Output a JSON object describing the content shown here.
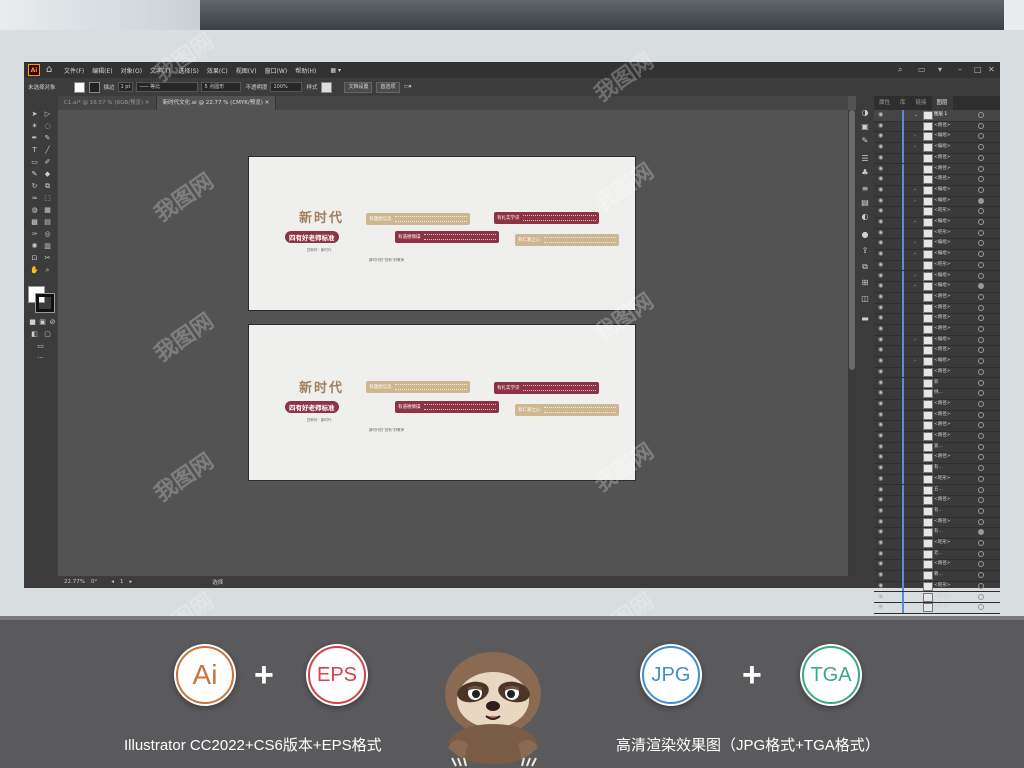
{
  "menubar": {
    "app_logo": "Ai",
    "items": [
      "文件(F)",
      "编辑(E)",
      "对象(O)",
      "文字(T)",
      "选择(S)",
      "效果(C)",
      "视图(V)",
      "窗口(W)",
      "帮助(H)"
    ]
  },
  "control_bar": {
    "selection_label": "未选择对象",
    "stroke_label": "描边",
    "stroke_value": "1 pt",
    "stroke_style": "等比",
    "brush_value": "5 点圆形",
    "opacity_label": "不透明度",
    "opacity_value": "100%",
    "style_label": "样式",
    "doc_settings_button": "文档设置",
    "preferences_button": "首选项"
  },
  "doc_tabs": [
    {
      "label": "C1.ai* @ 16.57 % (RGB/预览)",
      "active": false
    },
    {
      "label": "新时代文化.ai @ 22.77 % (CMYK/预览)",
      "active": true
    }
  ],
  "artboard": {
    "title": "新时代",
    "banner": "四有好老师标准",
    "sub_left": "四有好 · 新时代",
    "sub_center": "新时代的“四有”好教师",
    "box1": "有理想信念",
    "box2": "有道德情操",
    "box3": "有扎实学识",
    "box4": "有仁爱之心"
  },
  "statusbar": {
    "zoom": "22.77%",
    "rotation": "0°",
    "page": "1",
    "tool": "选择"
  },
  "panel_tabs": [
    "属性",
    "库",
    "链接",
    "图层"
  ],
  "layers": [
    {
      "name": "图层 1",
      "top": true,
      "circle": "empty"
    },
    {
      "name": "<路径>",
      "circle": "empty"
    },
    {
      "name": "<编组>",
      "arrow": true,
      "circle": "empty"
    },
    {
      "name": "<编组>",
      "arrow": true,
      "circle": "empty"
    },
    {
      "name": "<路径>",
      "circle": "empty"
    },
    {
      "name": "<路径>",
      "circle": "empty"
    },
    {
      "name": "<路径>",
      "circle": "empty"
    },
    {
      "name": "<编组>",
      "arrow": true,
      "circle": "empty"
    },
    {
      "name": "<编组>",
      "arrow": true,
      "circle": "filled"
    },
    {
      "name": "<矩形>",
      "circle": "empty"
    },
    {
      "name": "<编组>",
      "arrow": true,
      "circle": "empty"
    },
    {
      "name": "<矩形>",
      "circle": "empty"
    },
    {
      "name": "<编组>",
      "arrow": true,
      "circle": "empty"
    },
    {
      "name": "<编组>",
      "arrow": true,
      "circle": "empty"
    },
    {
      "name": "<矩形>",
      "circle": "empty"
    },
    {
      "name": "<编组>",
      "arrow": true,
      "circle": "empty"
    },
    {
      "name": "<编组>",
      "arrow": true,
      "circle": "filled"
    },
    {
      "name": "<路径>",
      "circle": "empty"
    },
    {
      "name": "<路径>",
      "circle": "empty"
    },
    {
      "name": "<路径>",
      "circle": "empty"
    },
    {
      "name": "<路径>",
      "circle": "empty"
    },
    {
      "name": "<编组>",
      "arrow": true,
      "circle": "empty"
    },
    {
      "name": "<路径>",
      "circle": "empty"
    },
    {
      "name": "<编组>",
      "arrow": true,
      "circle": "empty"
    },
    {
      "name": "<路径>",
      "circle": "empty"
    },
    {
      "name": "新",
      "circle": "empty"
    },
    {
      "name": "挑...",
      "circle": "empty"
    },
    {
      "name": "<路径>",
      "circle": "empty"
    },
    {
      "name": "<路径>",
      "circle": "empty"
    },
    {
      "name": "<路径>",
      "circle": "empty"
    },
    {
      "name": "<路径>",
      "circle": "empty"
    },
    {
      "name": "爱...",
      "circle": "empty"
    },
    {
      "name": "<路径>",
      "circle": "empty"
    },
    {
      "name": "有...",
      "circle": "empty"
    },
    {
      "name": "<矩形>",
      "circle": "empty"
    },
    {
      "name": "五...",
      "circle": "empty"
    },
    {
      "name": "<路径>",
      "circle": "empty"
    },
    {
      "name": "有...",
      "circle": "empty"
    },
    {
      "name": "<路径>",
      "circle": "empty"
    },
    {
      "name": "有...",
      "circle": "filled"
    },
    {
      "name": "<矩形>",
      "circle": "empty"
    },
    {
      "name": "老...",
      "circle": "empty"
    },
    {
      "name": "<路径>",
      "circle": "empty"
    },
    {
      "name": "教...",
      "circle": "empty"
    },
    {
      "name": "<矩形>",
      "circle": "empty"
    },
    {
      "name": "<路径>",
      "circle": "empty"
    },
    {
      "name": "<路径>",
      "circle": "empty"
    }
  ],
  "watermark": "我图网",
  "bottom": {
    "badge_ai": "Ai",
    "badge_eps": "EPS",
    "badge_jpg": "JPG",
    "badge_tga": "TGA",
    "plus": "+",
    "caption_left": "Illustrator CC2022+CS6版本+EPS格式",
    "caption_right": "高清渲染效果图（JPG格式+TGA格式）"
  },
  "colors": {
    "accent_red": "#8e3345",
    "accent_tan": "#cdb690",
    "ai_orange": "#c8743a",
    "eps_red": "#d3414a",
    "jpg_blue": "#3f8fd0",
    "tga_green": "#3aa889"
  }
}
